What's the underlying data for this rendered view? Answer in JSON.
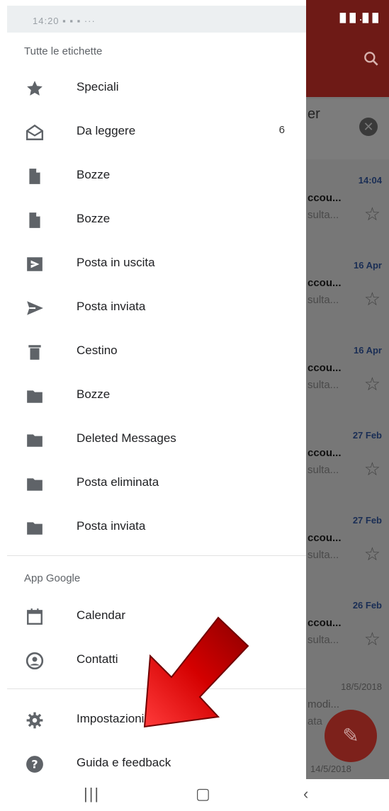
{
  "status": {
    "time": "14:20",
    "right_icons": "█ █ .█ █"
  },
  "background": {
    "promo_text": "er",
    "rows": [
      {
        "date": "14:04",
        "subject": "ccou...",
        "snippet": "sulta..."
      },
      {
        "date": "16 Apr",
        "subject": "ccou...",
        "snippet": "sulta..."
      },
      {
        "date": "16 Apr",
        "subject": "ccou...",
        "snippet": "sulta..."
      },
      {
        "date": "27 Feb",
        "subject": "ccou...",
        "snippet": "sulta..."
      },
      {
        "date": "27 Feb",
        "subject": "ccou...",
        "snippet": "sulta..."
      },
      {
        "date": "26 Feb",
        "subject": "ccou...",
        "snippet": "sulta..."
      },
      {
        "date": "18/5/2018",
        "subject": "modi...",
        "snippet": "ata"
      }
    ],
    "last_date": "14/5/2018"
  },
  "drawer": {
    "all_labels_header": "Tutte le etichette",
    "items": [
      {
        "label": "Speciali",
        "icon": "star-icon"
      },
      {
        "label": "Da leggere",
        "icon": "open-mail-icon",
        "count": "6"
      },
      {
        "label": "Bozze",
        "icon": "draft-icon"
      },
      {
        "label": "Bozze",
        "icon": "draft-icon"
      },
      {
        "label": "Posta in uscita",
        "icon": "outbox-icon"
      },
      {
        "label": "Posta inviata",
        "icon": "send-icon"
      },
      {
        "label": "Cestino",
        "icon": "trash-icon"
      },
      {
        "label": "Bozze",
        "icon": "folder-icon"
      },
      {
        "label": "Deleted Messages",
        "icon": "folder-icon"
      },
      {
        "label": "Posta eliminata",
        "icon": "folder-icon"
      },
      {
        "label": "Posta inviata",
        "icon": "folder-icon"
      }
    ],
    "google_apps_header": "App Google",
    "apps": [
      {
        "label": "Calendar",
        "icon": "calendar-icon"
      },
      {
        "label": "Contatti",
        "icon": "contacts-icon"
      }
    ],
    "settings": [
      {
        "label": "Impostazioni",
        "icon": "gear-icon"
      },
      {
        "label": "Guida e feedback",
        "icon": "help-icon"
      }
    ]
  },
  "colors": {
    "accent": "#6e1a16",
    "arrow": "#cc0000"
  }
}
